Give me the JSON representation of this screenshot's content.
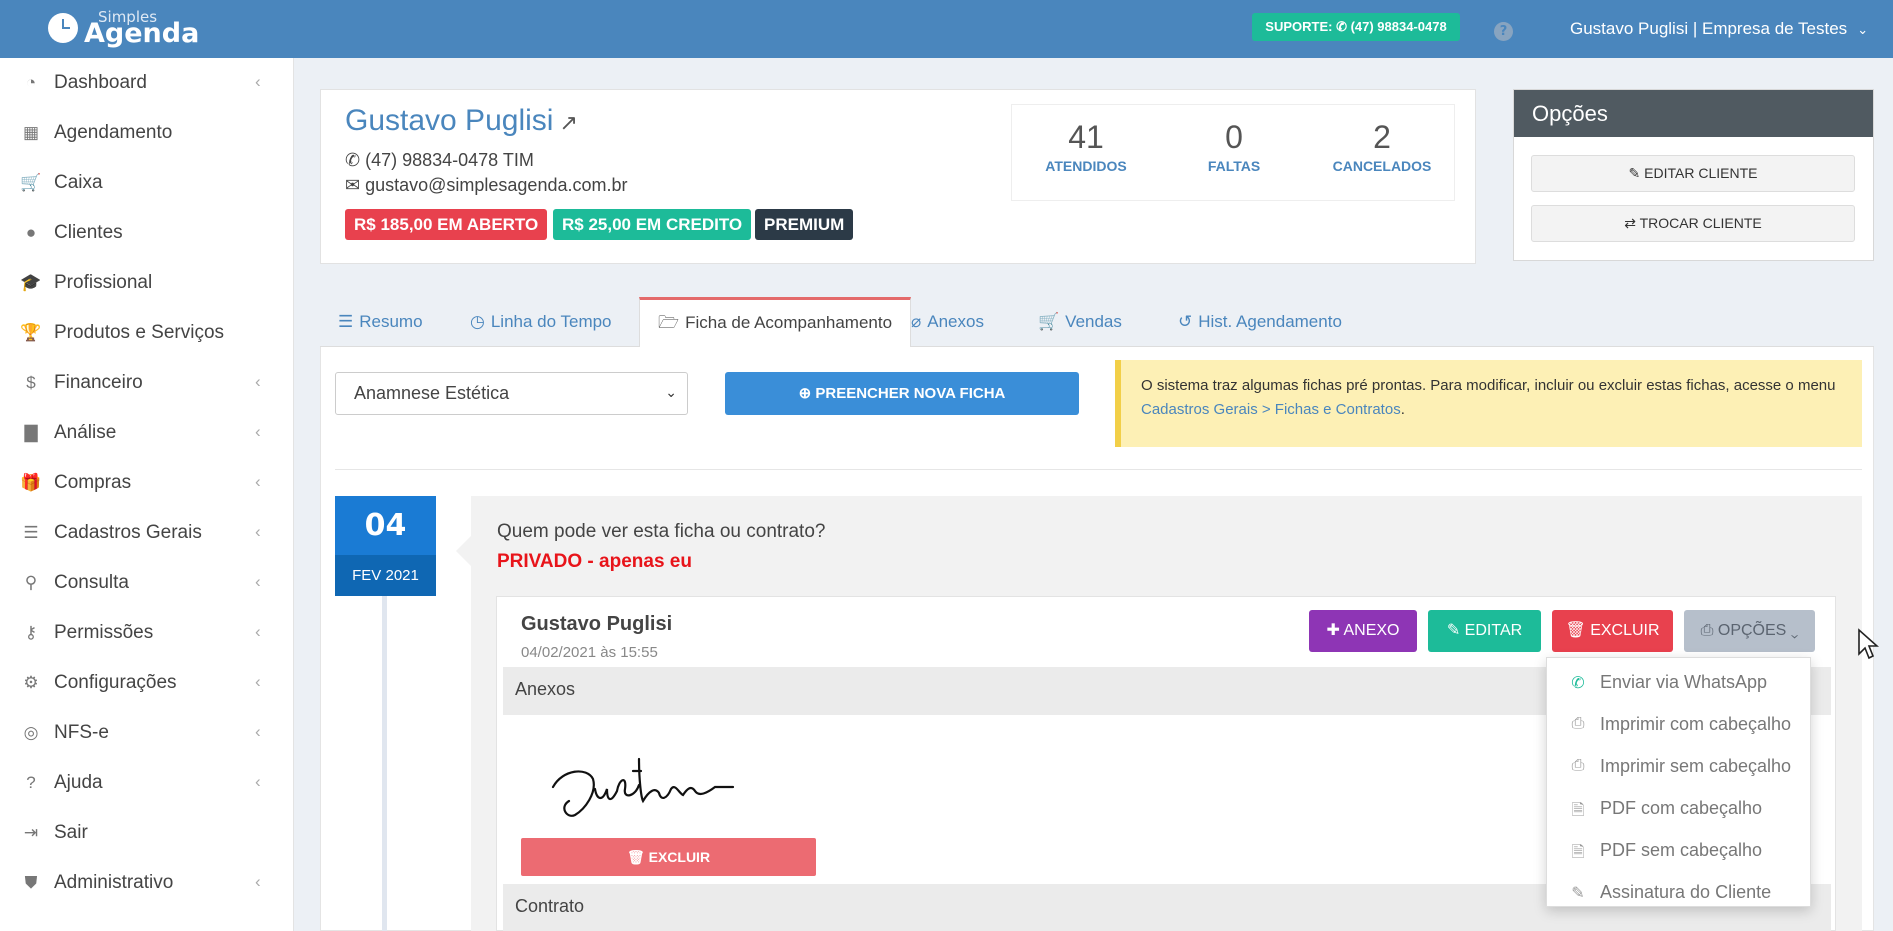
{
  "brand": {
    "line1": "Simples",
    "line2": "Agenda"
  },
  "topbar": {
    "support_label": "SUPORTE: ✆ (47) 98834-0478",
    "help_label": "?",
    "user": "Gustavo Puglisi | Empresa de Testes",
    "user_caret": "⌄"
  },
  "sidebar": {
    "items": [
      {
        "label": "Dashboard",
        "icon": "pie-chart-icon",
        "glyph": "◔",
        "chevron": "‹"
      },
      {
        "label": "Agendamento",
        "icon": "calendar-icon",
        "glyph": "▦",
        "chevron": ""
      },
      {
        "label": "Caixa",
        "icon": "cart-icon",
        "glyph": "🛒",
        "chevron": ""
      },
      {
        "label": "Clientes",
        "icon": "user-icon",
        "glyph": "●",
        "chevron": ""
      },
      {
        "label": "Profissional",
        "icon": "graduation-cap-icon",
        "glyph": "🎓",
        "chevron": ""
      },
      {
        "label": "Produtos e Serviços",
        "icon": "trophy-icon",
        "glyph": "🏆",
        "chevron": ""
      },
      {
        "label": "Financeiro",
        "icon": "dollar-icon",
        "glyph": "$",
        "chevron": "‹"
      },
      {
        "label": "Análise",
        "icon": "bar-chart-icon",
        "glyph": "▇",
        "chevron": "‹"
      },
      {
        "label": "Compras",
        "icon": "gift-icon",
        "glyph": "🎁",
        "chevron": "‹"
      },
      {
        "label": "Cadastros Gerais",
        "icon": "database-icon",
        "glyph": "☰",
        "chevron": "‹"
      },
      {
        "label": "Consulta",
        "icon": "search-icon",
        "glyph": "⚲",
        "chevron": "‹"
      },
      {
        "label": "Permissões",
        "icon": "key-icon",
        "glyph": "⚷",
        "chevron": "‹"
      },
      {
        "label": "Configurações",
        "icon": "gears-icon",
        "glyph": "⚙",
        "chevron": "‹"
      },
      {
        "label": "NFS-e",
        "icon": "target-icon",
        "glyph": "◎",
        "chevron": "‹"
      },
      {
        "label": "Ajuda",
        "icon": "question-icon",
        "glyph": "?",
        "chevron": "‹"
      },
      {
        "label": "Sair",
        "icon": "sign-out-icon",
        "glyph": "⇥",
        "chevron": ""
      },
      {
        "label": "Administrativo",
        "icon": "shield-icon",
        "glyph": "⛊",
        "chevron": "‹"
      }
    ]
  },
  "client": {
    "name": "Gustavo Puglisi",
    "ext_icon": "↗",
    "phone": "✆ (47) 98834-0478 TIM",
    "email": "✉ gustavo@simplesagenda.com.br",
    "badges": [
      {
        "label": "R$ 185,00 EM ABERTO",
        "color": "#e8414e"
      },
      {
        "label": "R$ 25,00 EM CREDITO",
        "color": "#1dbb99"
      },
      {
        "label": "PREMIUM",
        "color": "#2c3a47"
      }
    ],
    "stats": [
      {
        "value": "41",
        "label": "ATENDIDOS"
      },
      {
        "value": "0",
        "label": "FALTAS"
      },
      {
        "value": "2",
        "label": "CANCELADOS"
      }
    ]
  },
  "options_panel": {
    "title": "Opções",
    "edit": "✎ EDITAR CLIENTE",
    "swap": "⇄ TROCAR CLIENTE"
  },
  "tabs": [
    {
      "label": "Resumo",
      "icon": "☰"
    },
    {
      "label": "Linha do Tempo",
      "icon": "◷"
    },
    {
      "label": "Ficha de Acompanhamento",
      "icon": "🗁"
    },
    {
      "label": "Anexos",
      "icon": "⌀"
    },
    {
      "label": "Vendas",
      "icon": "🛒"
    },
    {
      "label": "Hist. Agendamento",
      "icon": "↺"
    }
  ],
  "ficha": {
    "select_value": "Anamnese Estética",
    "fill_button": "⊕ PREENCHER NOVA FICHA",
    "alert_text": "O sistema traz algumas fichas pré prontas. Para modificar, incluir ou excluir estas fichas, acesse o menu ",
    "alert_link": "Cadastros Gerais > Fichas e Contratos",
    "alert_end": "."
  },
  "entry": {
    "day": "04",
    "month": "FEV 2021",
    "question": "Quem pode ver esta ficha ou contrato?",
    "privacy": "PRIVADO - apenas eu",
    "author": "Gustavo Puglisi",
    "datetime": "04/02/2021 às 15:55",
    "btn_anexo": "✚  ANEXO",
    "btn_editar": "✎  EDITAR",
    "btn_excluir": "🗑  EXCLUIR",
    "btn_opcoes": "⎙  OPÇÕES ⌄",
    "section_anexos": "Anexos",
    "signature_excluir": "🗑 EXCLUIR",
    "section_contrato": "Contrato"
  },
  "dropdown": {
    "items": [
      {
        "label": "Enviar via WhatsApp",
        "icon": "whatsapp-icon",
        "glyph": "✆"
      },
      {
        "label": "Imprimir com cabeçalho",
        "icon": "print-icon",
        "glyph": "⎙"
      },
      {
        "label": "Imprimir sem cabeçalho",
        "icon": "print-icon",
        "glyph": "⎙"
      },
      {
        "label": "PDF com cabeçalho",
        "icon": "pdf-icon",
        "glyph": "🗎"
      },
      {
        "label": "PDF sem cabeçalho",
        "icon": "pdf-icon",
        "glyph": "🗎"
      },
      {
        "label": "Assinatura do Cliente",
        "icon": "signature-icon",
        "glyph": "✎"
      }
    ]
  },
  "colors": {
    "header": "#4a86bd",
    "anexo": "#8e35b5",
    "editar": "#1dbb99",
    "excluir": "#e8414e",
    "opcoes": "#b6bfcb"
  }
}
